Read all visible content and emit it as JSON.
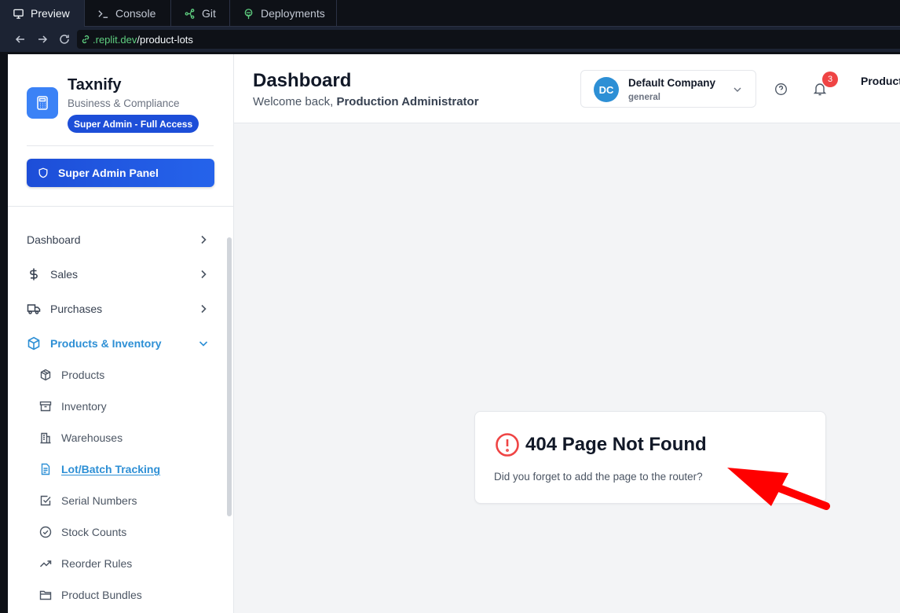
{
  "replit": {
    "tabs": [
      {
        "label": "Preview",
        "icon": "monitor-icon"
      },
      {
        "label": "Console",
        "icon": "terminal-icon"
      },
      {
        "label": "Git",
        "icon": "git-branch-icon"
      },
      {
        "label": "Deployments",
        "icon": "deployments-icon"
      }
    ],
    "url_host": ".replit.dev",
    "url_path": "/product-lots"
  },
  "brand": {
    "name": "Taxnify",
    "subtitle": "Business & Compliance",
    "access_badge": "Super Admin - Full Access",
    "admin_panel_button": "Super Admin Panel"
  },
  "nav": {
    "items": [
      {
        "label": "Dashboard"
      },
      {
        "label": "Sales",
        "icon": "dollar-icon"
      },
      {
        "label": "Purchases",
        "icon": "truck-icon"
      },
      {
        "label": "Products & Inventory",
        "icon": "package-icon",
        "expanded": true
      }
    ],
    "sub_items": [
      {
        "label": "Products",
        "icon": "box-icon"
      },
      {
        "label": "Inventory",
        "icon": "archive-icon"
      },
      {
        "label": "Warehouses",
        "icon": "building-icon"
      },
      {
        "label": "Lot/Batch Tracking",
        "icon": "document-icon",
        "active": true
      },
      {
        "label": "Serial Numbers",
        "icon": "checkbox-icon"
      },
      {
        "label": "Stock Counts",
        "icon": "check-circle-icon"
      },
      {
        "label": "Reorder Rules",
        "icon": "trending-up-icon"
      },
      {
        "label": "Product Bundles",
        "icon": "folder-icon"
      }
    ]
  },
  "header": {
    "title": "Dashboard",
    "welcome_prefix": "Welcome back,",
    "welcome_user": "Production Administrator",
    "company": {
      "initials": "DC",
      "name": "Default Company",
      "role": "general"
    },
    "notifications_count": "3",
    "user_label": "Product"
  },
  "error": {
    "title": "404 Page Not Found",
    "message": "Did you forget to add the page to the router?"
  },
  "colors": {
    "accent": "#2d8fd5",
    "admin_blue": "#1d4ed8",
    "error_red": "#ef4444",
    "annotation_red": "#ff0000"
  }
}
